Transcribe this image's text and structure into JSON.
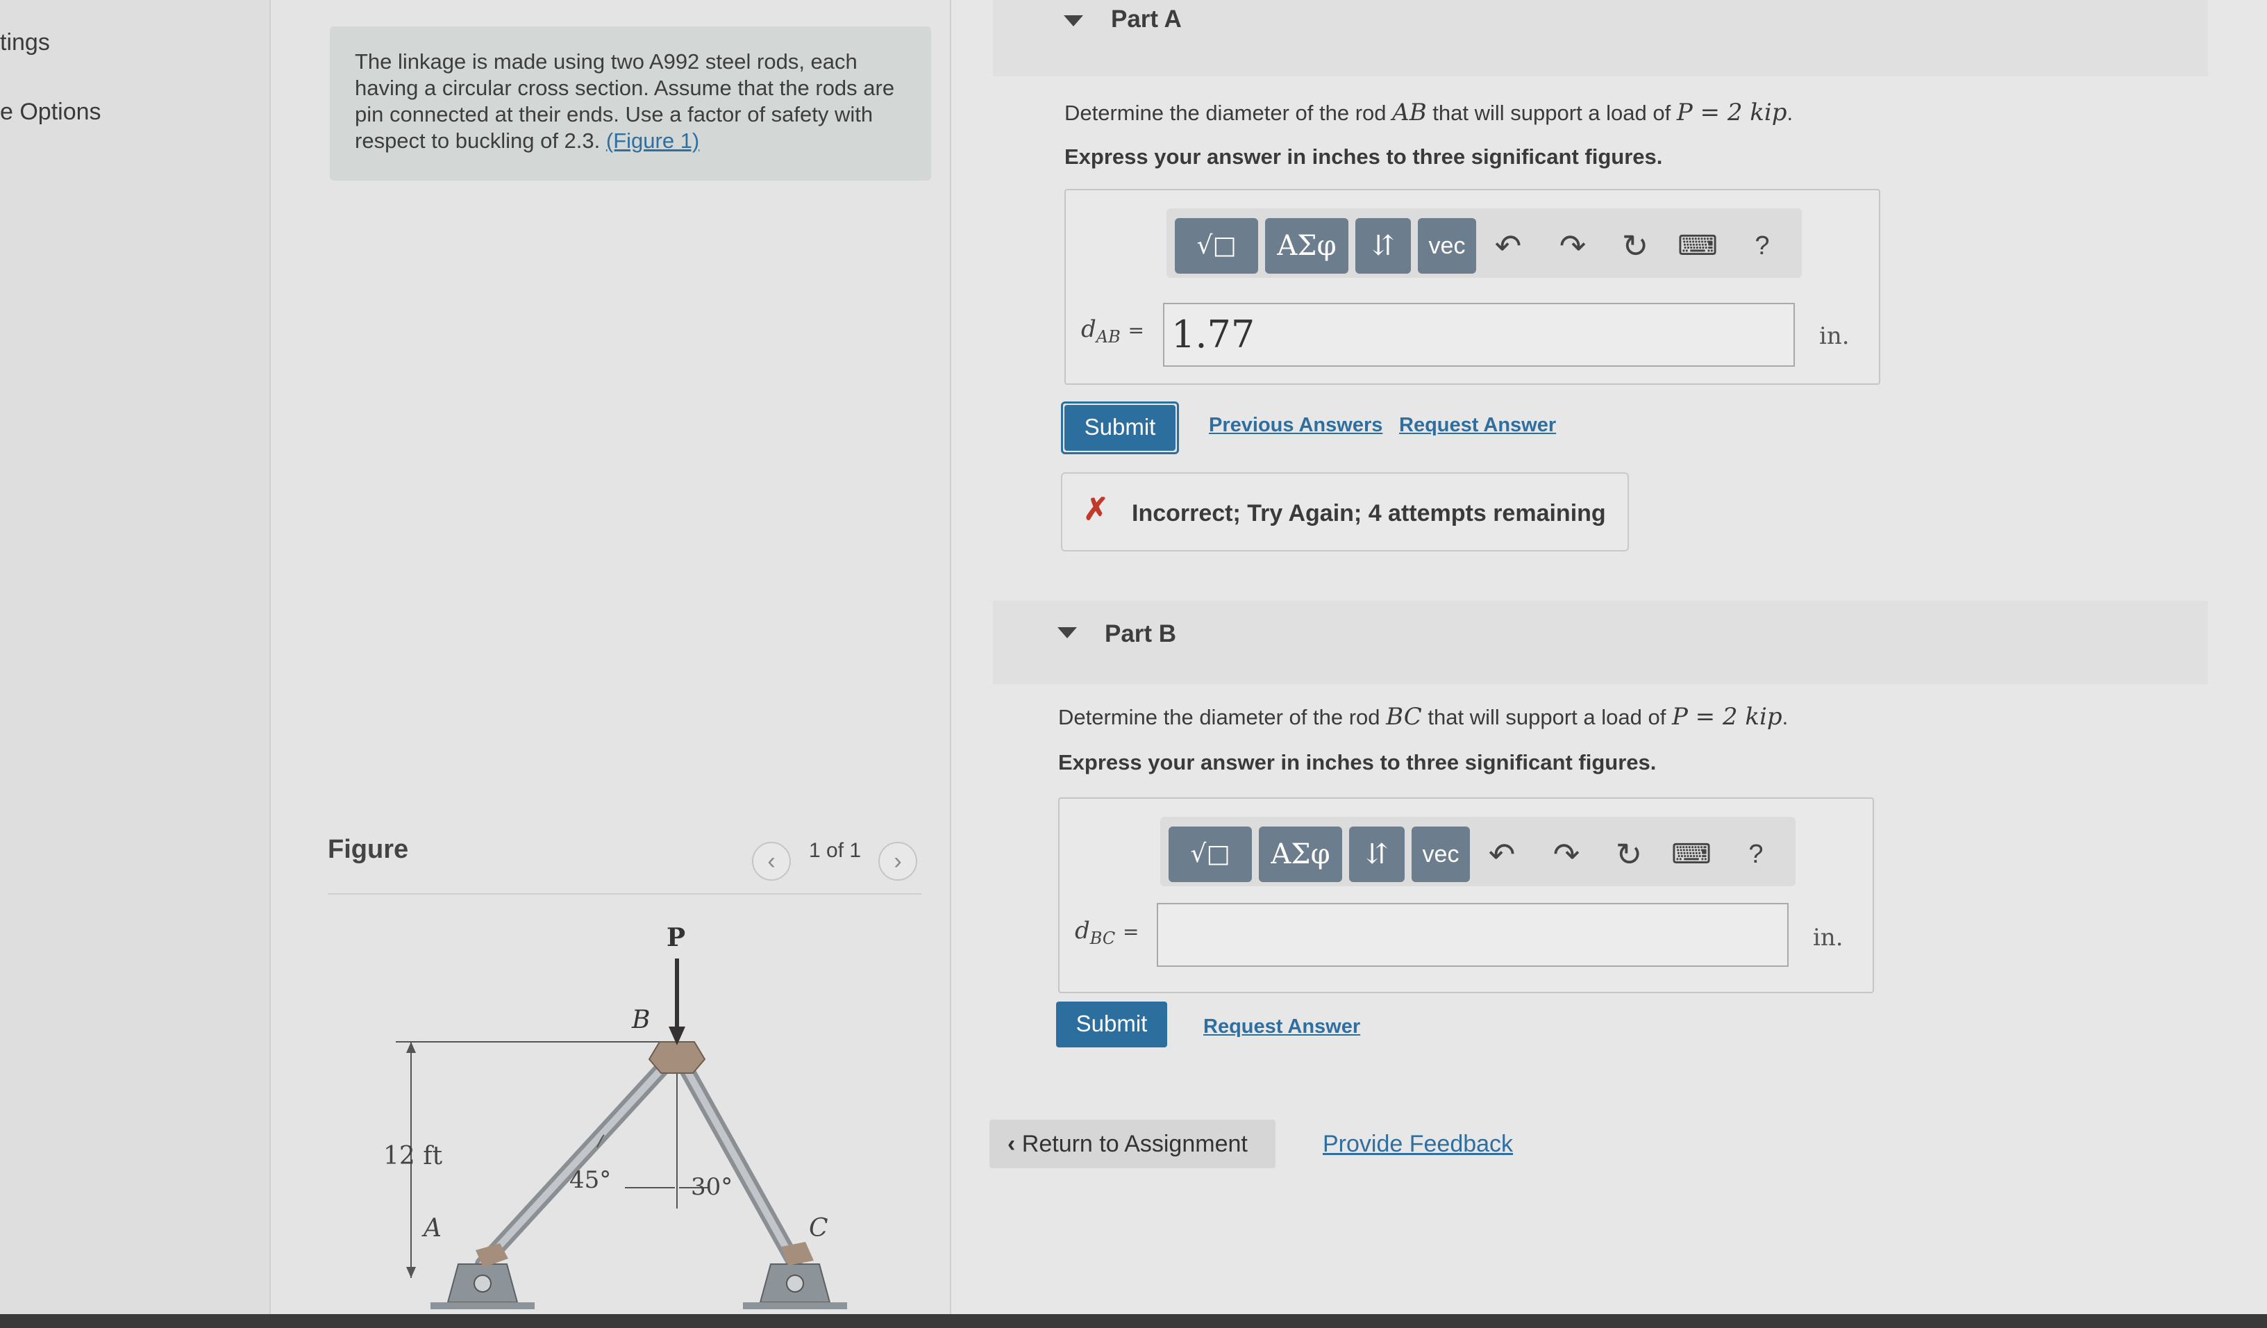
{
  "nav": {
    "items": [
      "tings",
      "e Options"
    ]
  },
  "problem": {
    "text": "The linkage is made using two A992 steel rods, each having a circular cross section. Assume that the rods are pin connected at their ends. Use a factor of safety with respect to buckling of 2.3.",
    "figure_link": "(Figure 1)"
  },
  "figure": {
    "title": "Figure",
    "pager": "1 of 1",
    "prev_icon": "chevron-left-icon",
    "next_icon": "chevron-right-icon",
    "labels": {
      "P": "P",
      "B": "B",
      "A": "A",
      "C": "C",
      "height": "12 ft",
      "angle_left": "45°",
      "angle_right": "30°"
    }
  },
  "toolbar": {
    "templates": "√□",
    "greek": "ΑΣφ",
    "arrows": "⇵",
    "vec": "vec",
    "undo_icon": "undo-icon",
    "redo_icon": "redo-icon",
    "reset_icon": "reset-icon",
    "keyboard_icon": "keyboard-icon",
    "help": "?"
  },
  "partA": {
    "title": "Part A",
    "question_prefix": "Determine the diameter of the rod ",
    "rod": "AB",
    "question_mid": " that will support a load of ",
    "load": "P = 2 kip",
    "question_suffix": ".",
    "instruction": "Express your answer in inches to three significant figures.",
    "variable": "d",
    "variable_sub": "AB",
    "equals": "=",
    "value": "1.77",
    "unit": "in.",
    "submit": "Submit",
    "previous_answers": "Previous Answers",
    "request_answer": "Request Answer",
    "feedback_icon": "✗",
    "feedback": "Incorrect; Try Again; 4 attempts remaining"
  },
  "partB": {
    "title": "Part B",
    "question_prefix": "Determine the diameter of the rod ",
    "rod": "BC",
    "question_mid": " that will support a load of ",
    "load": "P = 2 kip",
    "question_suffix": ".",
    "instruction": "Express your answer in inches to three significant figures.",
    "variable": "d",
    "variable_sub": "BC",
    "equals": "=",
    "value": "",
    "unit": "in.",
    "submit": "Submit",
    "request_answer": "Request Answer"
  },
  "footer": {
    "return": "Return to Assignment",
    "return_icon": "chevron-left-icon",
    "provide_feedback": "Provide Feedback"
  },
  "colors": {
    "accent": "#2c6f9e",
    "toolbar_button": "#6c7e8e",
    "error": "#c0392b"
  }
}
